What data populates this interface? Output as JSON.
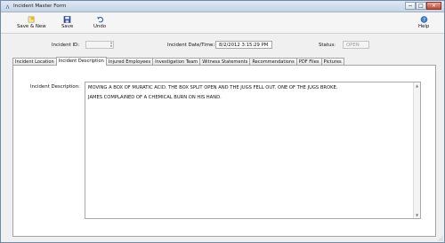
{
  "window": {
    "title": "Incident Master Form",
    "minimize_glyph": "−",
    "maximize_glyph": "□",
    "close_glyph": "×"
  },
  "toolbar": {
    "save_new": {
      "label": "Save & New",
      "icon": "save-new-icon"
    },
    "save": {
      "label": "Save",
      "icon": "floppy-disk-icon"
    },
    "undo": {
      "label": "Undo",
      "icon": "undo-arrow-icon"
    },
    "help": {
      "label": "Help",
      "icon": "help-icon"
    }
  },
  "header": {
    "incident_id_label": "Incident ID:",
    "incident_id_value": "",
    "incident_datetime_label": "Incident Date/Time:",
    "incident_datetime_value": "8/2/2012 3:15:29 PM",
    "status_label": "Status:",
    "status_value": "OPEN"
  },
  "tabs": [
    {
      "label": "Incident Location",
      "active": false
    },
    {
      "label": "Incident Description",
      "active": true
    },
    {
      "label": "Injured Employees",
      "active": false
    },
    {
      "label": "Investigation Team",
      "active": false
    },
    {
      "label": "Witness Statements",
      "active": false
    },
    {
      "label": "Recommendations",
      "active": false
    },
    {
      "label": "PDF Files",
      "active": false
    },
    {
      "label": "Pictures",
      "active": false
    }
  ],
  "description": {
    "label": "Incident Description:",
    "lines": [
      "MOVING A BOX OF MURATIC ACID.  THE BOX SPLIT OPEN AND THE JUGS FELL OUT.  ONE OF THE JUGS BROKE.",
      "JAMES COMPLAINED OF A CHEMICAL BURN ON HIS HAND."
    ]
  },
  "colors": {
    "titlebar": "#c6d4e5",
    "close_button": "#c0452f",
    "window_bg": "#f0f0f0"
  }
}
